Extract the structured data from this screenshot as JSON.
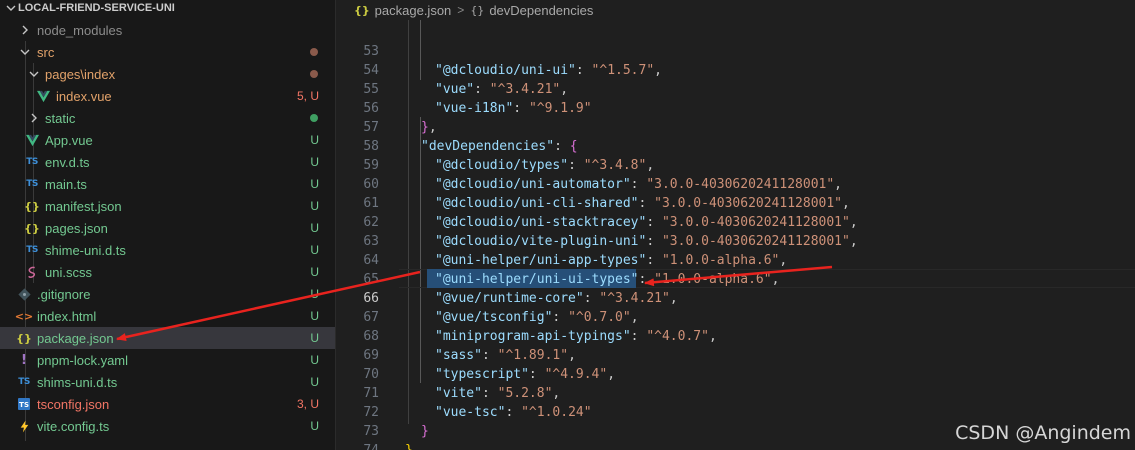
{
  "explorer": {
    "root": "LOCAL-FRIEND-SERVICE-UNI",
    "rows": [
      {
        "label": "node_modules"
      },
      {
        "label": "src"
      },
      {
        "label": "pages\\index"
      },
      {
        "label": "index.vue",
        "status": "5, U"
      },
      {
        "label": "static"
      },
      {
        "label": "App.vue",
        "status": "U",
        "icon": "V"
      },
      {
        "label": "env.d.ts",
        "status": "U",
        "icon": "TS"
      },
      {
        "label": "main.ts",
        "status": "U",
        "icon": "TS"
      },
      {
        "label": "manifest.json",
        "status": "U",
        "icon": "{}"
      },
      {
        "label": "pages.json",
        "status": "U",
        "icon": "{}"
      },
      {
        "label": "shime-uni.d.ts",
        "status": "U",
        "icon": "TS"
      },
      {
        "label": "uni.scss",
        "status": "U"
      },
      {
        "label": ".gitignore",
        "status": "U"
      },
      {
        "label": "index.html",
        "status": "U",
        "icon": "<>"
      },
      {
        "label": "package.json",
        "status": "U",
        "icon": "{}"
      },
      {
        "label": "pnpm-lock.yaml",
        "status": "U",
        "icon": "!"
      },
      {
        "label": "shims-uni.d.ts",
        "status": "U",
        "icon": "TS"
      },
      {
        "label": "tsconfig.json",
        "status": "3, U",
        "icon": "TS"
      },
      {
        "label": "vite.config.ts",
        "status": "U"
      }
    ]
  },
  "breadcrumb": {
    "icon": "{}",
    "file": "package.json",
    "separator": ">",
    "node_icon": "{}",
    "node": "devDependencies"
  },
  "code": {
    "lines": [
      {
        "n": "53",
        "key": "\"@dcloudio/uni-ui\"",
        "val": "\"^1.5.7\""
      },
      {
        "n": "54",
        "key": "\"vue\"",
        "val": "\"^3.4.21\""
      },
      {
        "n": "55",
        "key": "\"vue-i18n\"",
        "val": "\"^9.1.9\""
      },
      {
        "n": "56",
        "close": "}"
      },
      {
        "n": "57",
        "key": "\"devDependencies\"",
        "open": "{"
      },
      {
        "n": "58",
        "key": "\"@dcloudio/types\"",
        "val": "\"^3.4.8\""
      },
      {
        "n": "59",
        "key": "\"@dcloudio/uni-automator\"",
        "val": "\"3.0.0-4030620241128001\""
      },
      {
        "n": "60",
        "key": "\"@dcloudio/uni-cli-shared\"",
        "val": "\"3.0.0-4030620241128001\""
      },
      {
        "n": "61",
        "key": "\"@dcloudio/uni-stacktracey\"",
        "val": "\"3.0.0-4030620241128001\""
      },
      {
        "n": "62",
        "key": "\"@dcloudio/vite-plugin-uni\"",
        "val": "\"3.0.0-4030620241128001\""
      },
      {
        "n": "63",
        "key": "\"@uni-helper/uni-app-types\"",
        "val": "\"1.0.0-alpha.6\""
      },
      {
        "n": "64",
        "key": "\"@uni-helper/uni-ui-types\"",
        "val": "\"1.0.0-alpha.6\""
      },
      {
        "n": "65",
        "key": "\"@vue/runtime-core\"",
        "val": "\"^3.4.21\""
      },
      {
        "n": "66",
        "key": "\"@vue/tsconfig\"",
        "val": "\"^0.7.0\""
      },
      {
        "n": "67",
        "key": "\"miniprogram-api-typings\"",
        "val": "\"^4.0.7\""
      },
      {
        "n": "68",
        "key": "\"sass\"",
        "val": "\"^1.89.1\""
      },
      {
        "n": "69",
        "key": "\"typescript\"",
        "val": "\"^4.9.4\""
      },
      {
        "n": "70",
        "key": "\"vite\"",
        "val": "\"5.2.8\""
      },
      {
        "n": "71",
        "key": "\"vue-tsc\"",
        "val": "\"^1.0.24\""
      },
      {
        "n": "72",
        "close": "}"
      },
      {
        "n": "73",
        "close": "}"
      },
      {
        "n": "74"
      }
    ]
  },
  "watermark": "CSDN @Angindem",
  "colors": {
    "annotation_arrow": "#e8231e",
    "git_untracked": "#73c991",
    "git_error": "#f27565",
    "selection": "#264f78"
  }
}
